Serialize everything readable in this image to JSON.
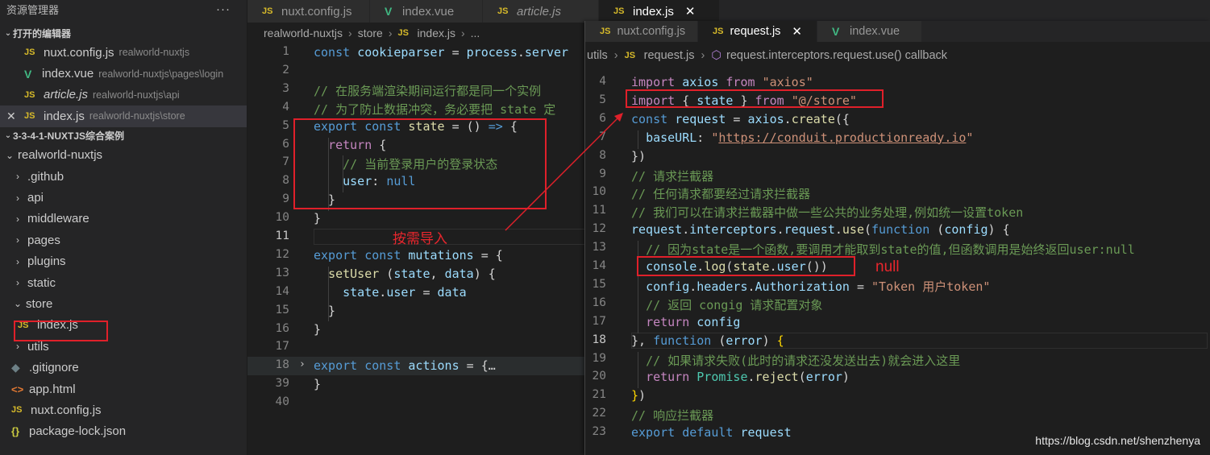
{
  "sidebar": {
    "title": "资源管理器",
    "more": "···",
    "open_editors_title": "打开的编辑器",
    "open_editors": [
      {
        "name": "nuxt.config.js",
        "path": "realworld-nuxtjs",
        "icon": "js"
      },
      {
        "name": "index.vue",
        "path": "realworld-nuxtjs\\pages\\login",
        "icon": "vue"
      },
      {
        "name": "article.js",
        "path": "realworld-nuxtjs\\api",
        "icon": "js",
        "italic": true
      },
      {
        "name": "index.js",
        "path": "realworld-nuxtjs\\store",
        "icon": "js",
        "close": "✕"
      }
    ],
    "workspace_title": "3-3-4-1-NUXTJS综合案例",
    "tree": [
      {
        "label": "realworld-nuxtjs",
        "kind": "folder-open",
        "indent": 1
      },
      {
        "label": ".github",
        "kind": "folder",
        "indent": 2
      },
      {
        "label": "api",
        "kind": "folder",
        "indent": 2
      },
      {
        "label": "middleware",
        "kind": "folder",
        "indent": 2
      },
      {
        "label": "pages",
        "kind": "folder",
        "indent": 2
      },
      {
        "label": "plugins",
        "kind": "folder",
        "indent": 2
      },
      {
        "label": "static",
        "kind": "folder",
        "indent": 2
      },
      {
        "label": "store",
        "kind": "folder-open",
        "indent": 2
      },
      {
        "label": "index.js",
        "kind": "js",
        "indent": 3
      },
      {
        "label": "utils",
        "kind": "folder",
        "indent": 2
      },
      {
        "label": ".gitignore",
        "kind": "dot",
        "indent": 2
      },
      {
        "label": "app.html",
        "kind": "html",
        "indent": 2
      },
      {
        "label": "nuxt.config.js",
        "kind": "js",
        "indent": 2
      },
      {
        "label": "package-lock.json",
        "kind": "json",
        "indent": 2
      }
    ]
  },
  "left_tabs": [
    {
      "label": "nuxt.config.js",
      "icon": "js"
    },
    {
      "label": "index.vue",
      "icon": "vue"
    },
    {
      "label": "article.js",
      "icon": "js",
      "italic": true
    },
    {
      "label": "index.js",
      "icon": "js",
      "active": true,
      "close": "✕"
    }
  ],
  "left_breadcrumb": [
    "realworld-nuxtjs",
    "store",
    "index.js",
    "..."
  ],
  "left_code": [
    {
      "n": "1",
      "html": "<span class='k'>const</span> <span class='v'>cookieparser</span> = <span class='v'>process</span>.<span class='v'>server</span>"
    },
    {
      "n": "2",
      "html": ""
    },
    {
      "n": "3",
      "html": "<span class='c'>// 在服务端渲染期间运行都是同一个实例</span>"
    },
    {
      "n": "4",
      "html": "<span class='c'>// 为了防止数据冲突，务必要把 state 定</span>"
    },
    {
      "n": "5",
      "html": "<span class='k'>export</span> <span class='k'>const</span> <span class='f'>state</span> = () <span class='k'>=&gt;</span> {"
    },
    {
      "n": "6",
      "html": "  <span class='kc'>return</span> {"
    },
    {
      "n": "7",
      "html": "    <span class='c'>// 当前登录用户的登录状态</span>"
    },
    {
      "n": "8",
      "html": "    <span class='v'>user</span>: <span class='k'>null</span>"
    },
    {
      "n": "9",
      "html": "  }"
    },
    {
      "n": "10",
      "html": "}"
    },
    {
      "n": "11",
      "html": ""
    },
    {
      "n": "12",
      "html": "<span class='k'>export</span> <span class='k'>const</span> <span class='v'>mutations</span> = {"
    },
    {
      "n": "13",
      "html": "  <span class='f'>setUser</span> (<span class='v'>state</span>, <span class='v'>data</span>) {"
    },
    {
      "n": "14",
      "html": "    <span class='v'>state</span>.<span class='v'>user</span> = <span class='v'>data</span>"
    },
    {
      "n": "15",
      "html": "  }"
    },
    {
      "n": "16",
      "html": "}"
    },
    {
      "n": "17",
      "html": ""
    },
    {
      "n": "18",
      "html": "<span class='k'>export</span> <span class='k'>const</span> <span class='v'>actions</span> = {<span class='p'>…</span>"
    },
    {
      "n": "39",
      "html": "}"
    },
    {
      "n": "40",
      "html": ""
    }
  ],
  "right_tabs": [
    {
      "label": "nuxt.config.js",
      "icon": "js"
    },
    {
      "label": "request.js",
      "icon": "js",
      "active": true,
      "close": "✕"
    },
    {
      "label": "index.vue",
      "icon": "vue"
    }
  ],
  "right_breadcrumb": {
    "prefix": "utils",
    "file": "request.js",
    "symbol": "request.interceptors.request.use() callback"
  },
  "right_code": [
    {
      "n": "4",
      "html": "<span class='kc'>import</span> <span class='v'>axios</span> <span class='kc'>from</span> <span class='s'>\"axios\"</span>"
    },
    {
      "n": "5",
      "html": "<span class='kc'>import</span> { <span class='v'>state</span> } <span class='kc'>from</span> <span class='s'>\"@/store\"</span>"
    },
    {
      "n": "6",
      "html": "<span class='k'>const</span> <span class='v'>request</span> = <span class='v'>axios</span>.<span class='f'>create</span>({"
    },
    {
      "n": "7",
      "html": "  <span class='v'>baseURL</span>: <span class='s'>\"</span><span class='u'>https://conduit.productionready.io</span><span class='s'>\"</span>"
    },
    {
      "n": "8",
      "html": "})"
    },
    {
      "n": "9",
      "html": "<span class='c'>// 请求拦截器</span>"
    },
    {
      "n": "10",
      "html": "<span class='c'>// 任何请求都要经过请求拦截器</span>"
    },
    {
      "n": "11",
      "html": "<span class='c'>// 我们可以在请求拦截器中做一些公共的业务处理,例如统一设置token</span>"
    },
    {
      "n": "12",
      "html": "<span class='v'>request</span>.<span class='v'>interceptors</span>.<span class='v'>request</span>.<span class='f'>use</span>(<span class='k'>function</span> (<span class='v'>config</span>) {"
    },
    {
      "n": "13",
      "html": "  <span class='c'>// 因为state是一个函数,要调用才能取到state的值,但函数调用是始终返回user:null</span>"
    },
    {
      "n": "14",
      "html": "  <span class='v'>console</span>.<span class='f'>log</span>(<span class='f'>state</span>.<span class='v'>user</span>())"
    },
    {
      "n": "15",
      "html": "  <span class='v'>config</span>.<span class='v'>headers</span>.<span class='v'>Authorization</span> = <span class='s'>\"Token 用户token\"</span>"
    },
    {
      "n": "16",
      "html": "  <span class='c'>// 返回 congig 请求配置对象</span>"
    },
    {
      "n": "17",
      "html": "  <span class='kc'>return</span> <span class='v'>config</span>"
    },
    {
      "n": "18",
      "html": "}, <span class='k'>function</span> (<span class='v'>error</span>) <span class='br'>{</span>"
    },
    {
      "n": "19",
      "html": "  <span class='c'>// 如果请求失败(此时的请求还没发送出去)就会进入这里</span>"
    },
    {
      "n": "20",
      "html": "  <span class='kc'>return</span> <span class='t'>Promise</span>.<span class='f'>reject</span>(<span class='v'>error</span>)"
    },
    {
      "n": "21",
      "html": "<span class='br'>}</span>)"
    },
    {
      "n": "22",
      "html": "<span class='c'>// 响应拦截器</span>"
    },
    {
      "n": "23",
      "html": "<span class='k'>export</span> <span class='k'>default</span> <span class='v'>request</span>"
    }
  ],
  "annotations": {
    "import_hint": "按需导入",
    "null_result": "null"
  },
  "watermark": "https://blog.csdn.net/shenzhenya"
}
